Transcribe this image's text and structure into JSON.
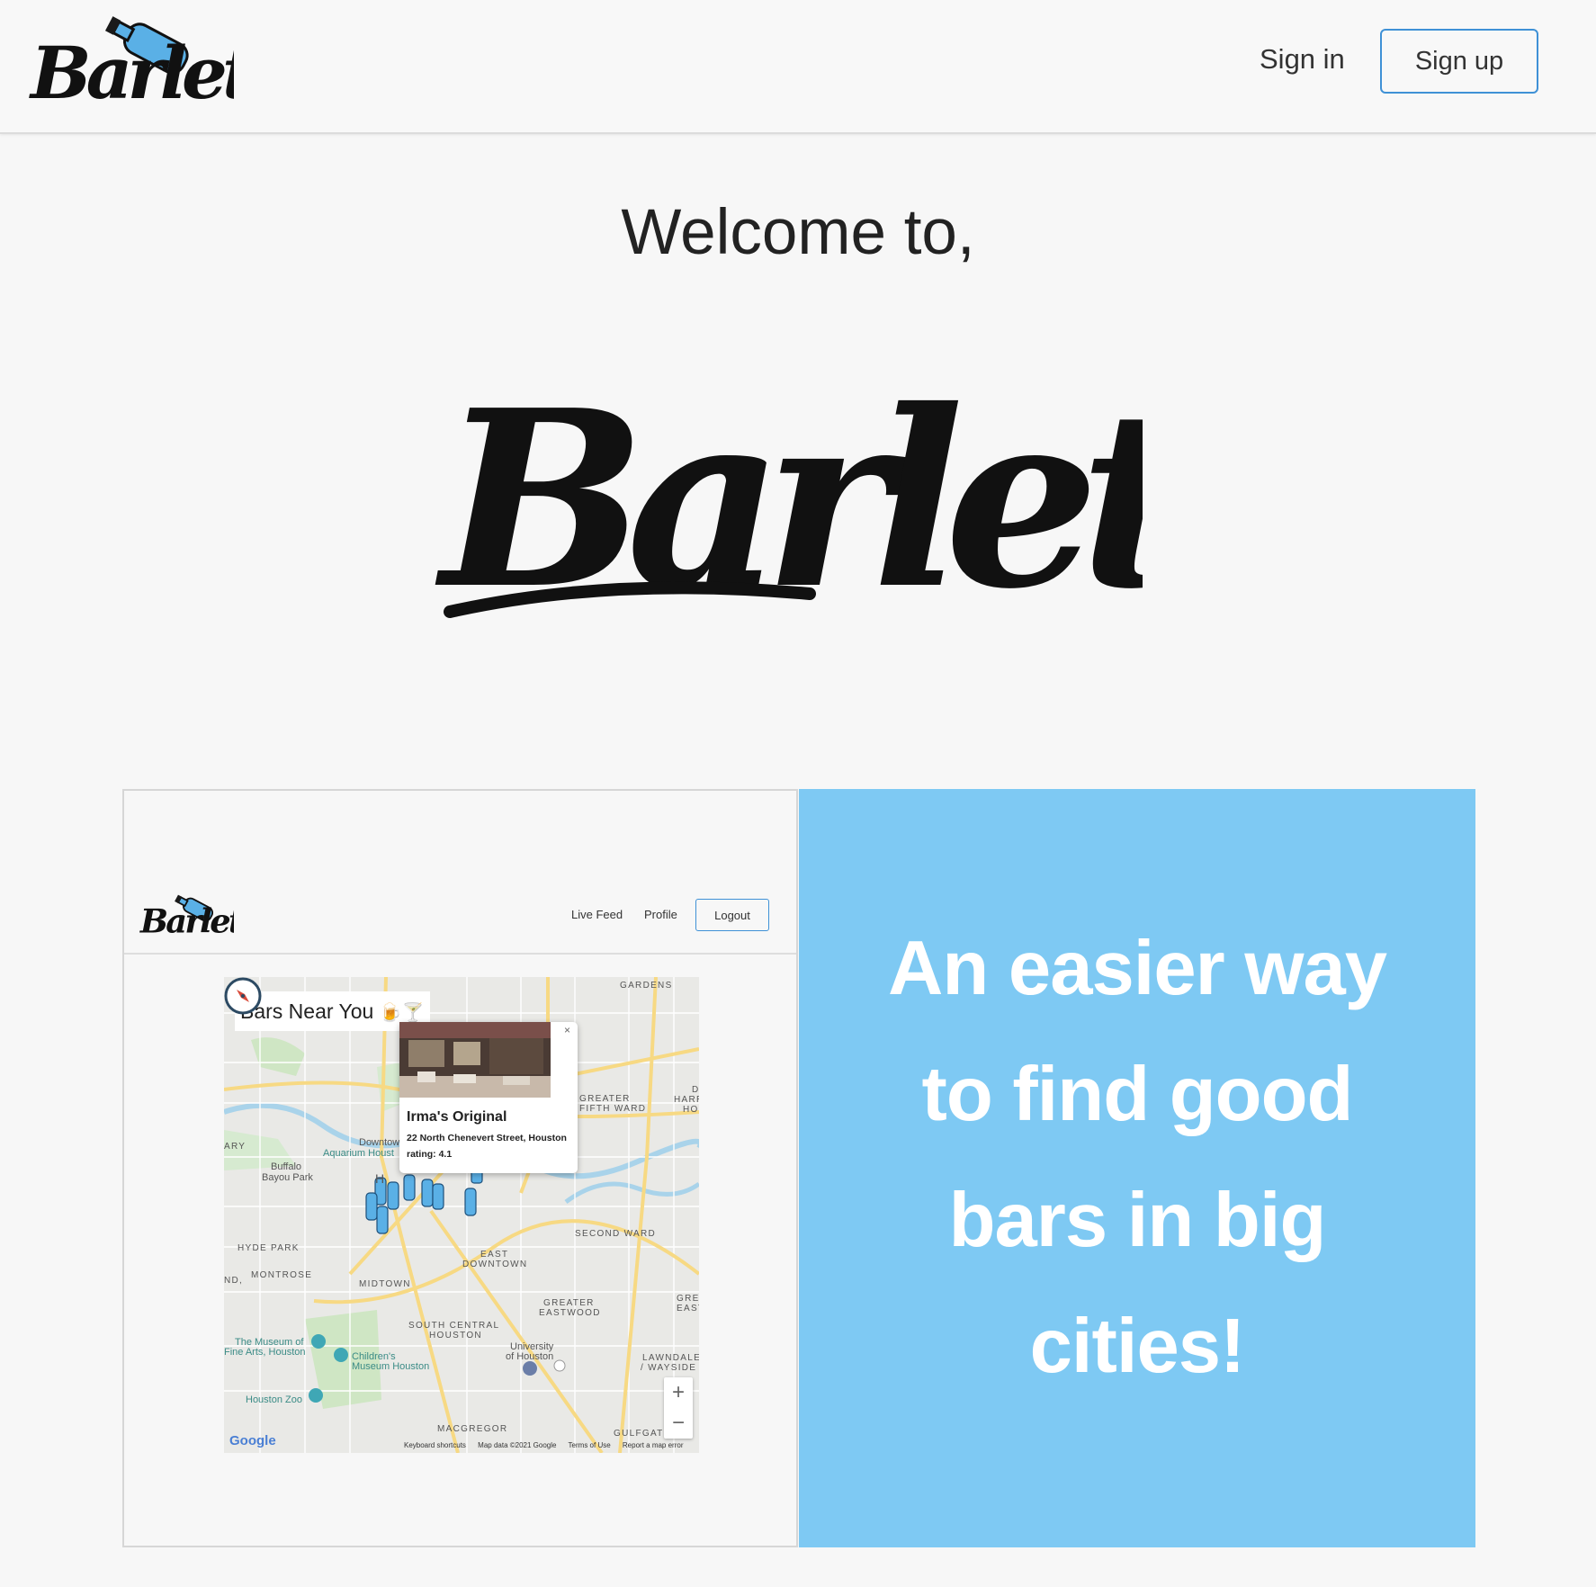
{
  "nav": {
    "logo_text": "Barlet",
    "signin_label": "Sign in",
    "signup_label": "Sign up"
  },
  "hero": {
    "welcome": "Welcome to,",
    "logo_text": "Barlet"
  },
  "feature": {
    "tagline": [
      "An easier way",
      "to find good",
      "bars in big",
      "cities!"
    ],
    "background_color": "#7ec9f3"
  },
  "screenshot": {
    "nav": {
      "logo_text": "Barlet",
      "live_feed": "Live Feed",
      "profile": "Profile",
      "logout": "Logout"
    },
    "map": {
      "title": "Bars Near You",
      "title_emojis": "🍺🍸",
      "popup": {
        "name": "Irma's Original",
        "address": "22 North Chenevert Street, Houston",
        "rating": "rating: 4.1",
        "close": "×"
      },
      "labels": [
        "GARDENS",
        "GREATER",
        "FIFTH WARD",
        "SECOND WARD",
        "EAST",
        "DOWNTOWN",
        "HYDE PARK",
        "MONTROSE",
        "MIDTOWN",
        "GREATER",
        "EASTWOOD",
        "SOUTH CENTRAL",
        "HOUSTON",
        "LAWNDALE",
        "/ WAYSIDE",
        "MACGREGOR",
        "GULFGATE",
        "ARY",
        "ND,",
        "GRE",
        "EAST",
        "D",
        "HARR",
        "HO"
      ],
      "pois": [
        "Downtown",
        "Aquarium Houst",
        "Buffalo",
        "Bayou Park",
        "The Museum of",
        "Fine Arts, Houston",
        "Children's",
        "Museum Houston",
        "University",
        "of Houston",
        "Houston Zoo",
        "H"
      ],
      "zoom_in": "+",
      "zoom_out": "−",
      "google": "Google",
      "footer": [
        "Keyboard shortcuts",
        "Map data ©2021 Google",
        "Terms of Use",
        "Report a map error"
      ]
    }
  }
}
